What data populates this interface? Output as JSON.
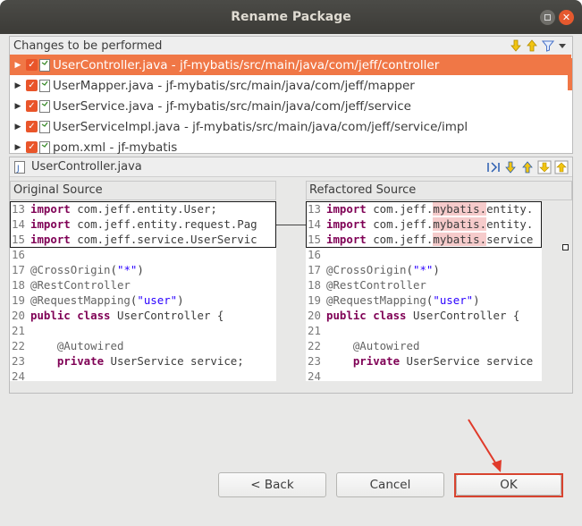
{
  "window": {
    "title": "Rename Package"
  },
  "changes": {
    "header": "Changes to be performed",
    "rows": [
      {
        "label": "UserController.java - jf-mybatis/src/main/java/com/jeff/controller"
      },
      {
        "label": "UserMapper.java - jf-mybatis/src/main/java/com/jeff/mapper"
      },
      {
        "label": "UserService.java - jf-mybatis/src/main/java/com/jeff/service"
      },
      {
        "label": "UserServiceImpl.java - jf-mybatis/src/main/java/com/jeff/service/impl"
      },
      {
        "label": "pom.xml - jf-mybatis"
      }
    ]
  },
  "preview": {
    "file": "UserController.java",
    "original_header": "Original Source",
    "refactored_header": "Refactored Source"
  },
  "buttons": {
    "back": "< Back",
    "cancel": "Cancel",
    "ok": "OK"
  },
  "colors": {
    "selection": "#f07746",
    "checkbox": "#e9552a",
    "keyword": "#7f0055",
    "string": "#2a00ff",
    "highlight": "#f6cbcb",
    "annotation_arrow": "#e03a2a"
  }
}
